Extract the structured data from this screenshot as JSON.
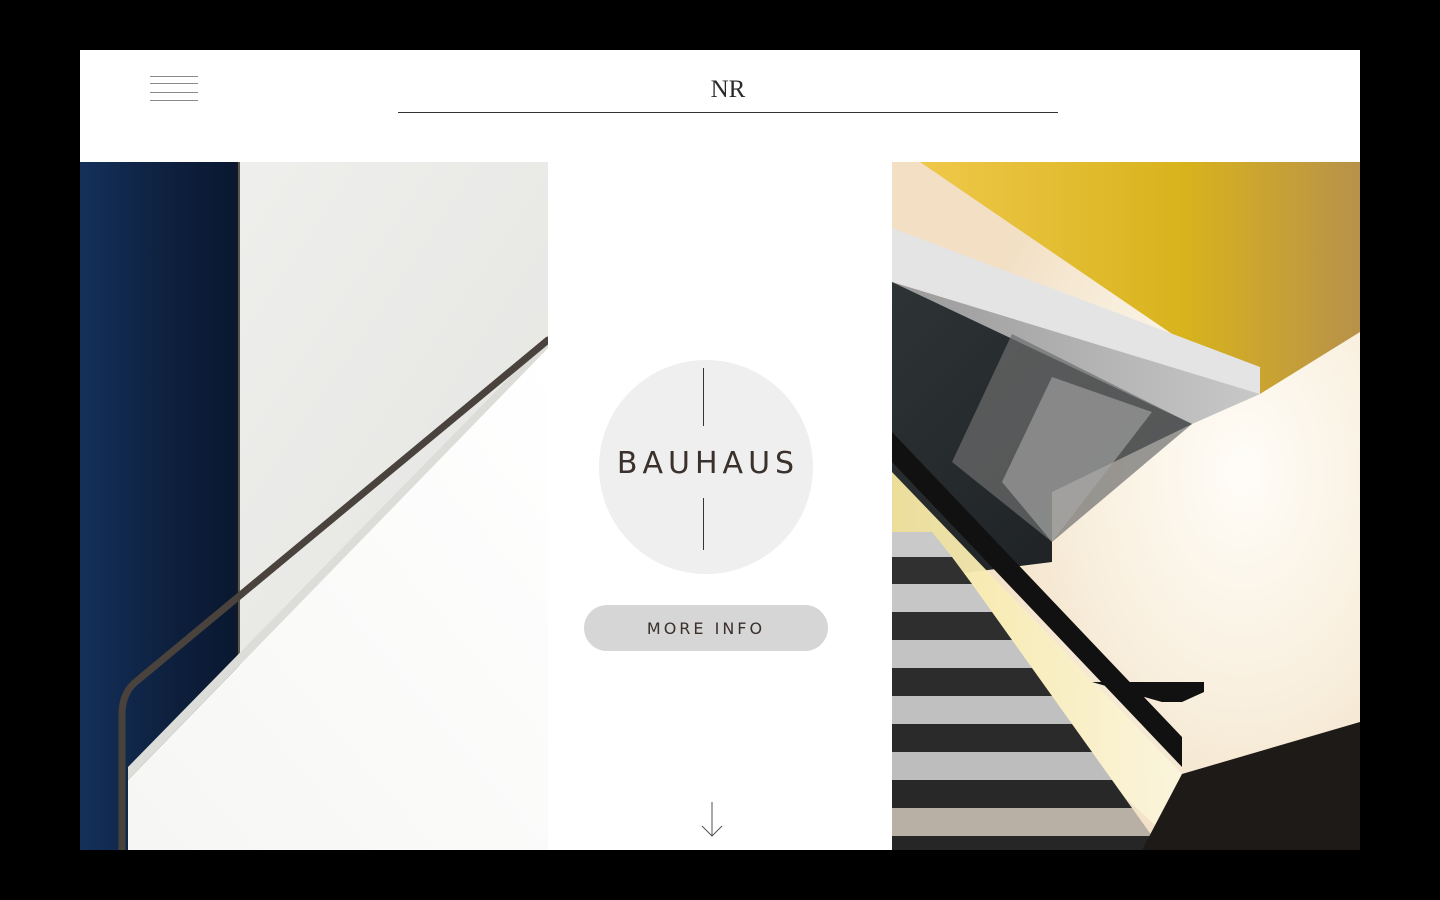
{
  "header": {
    "logo": "NR",
    "menu_icon": "hamburger-menu-icon"
  },
  "hero": {
    "title": "BAUHAUS",
    "button_label": "MORE INFO",
    "scroll_icon": "arrow-down-icon"
  },
  "images": {
    "left": "bauhaus-staircase-handrail-photo",
    "right": "bauhaus-staircase-illustration"
  },
  "colors": {
    "background": "#000000",
    "page": "#ffffff",
    "badge": "#efefef",
    "button": "#d6d6d6",
    "text": "#3a302c",
    "navy": "#0f2440",
    "yellow": "#e6bb2a"
  }
}
